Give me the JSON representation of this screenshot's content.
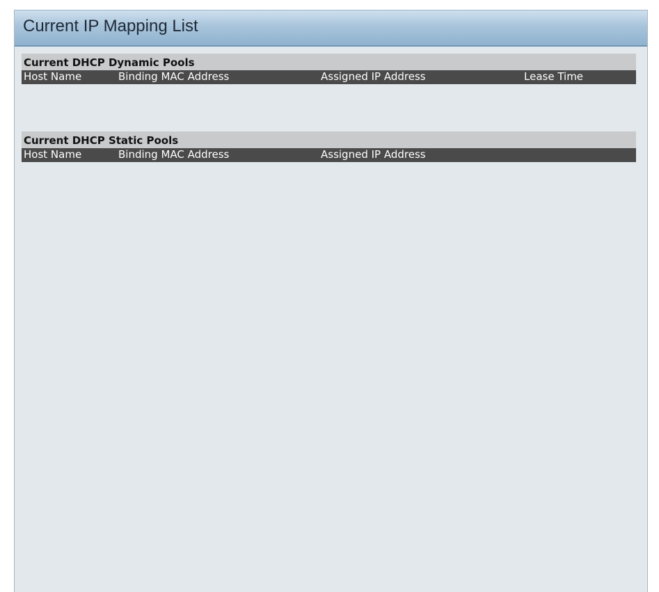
{
  "panel": {
    "title": "Current IP Mapping List"
  },
  "dynamic_pools": {
    "title": "Current DHCP Dynamic Pools",
    "columns": [
      "Host Name",
      "Binding MAC Address",
      "Assigned IP Address",
      "Lease Time"
    ],
    "rows": []
  },
  "static_pools": {
    "title": "Current DHCP Static Pools",
    "columns": [
      "Host Name",
      "Binding MAC Address",
      "Assigned IP Address"
    ],
    "rows": []
  },
  "colors": {
    "panel_background": "#e3e8ec",
    "header_gradient_top": "#cfe0ee",
    "header_gradient_bottom": "#8fb2cf",
    "section_title_background": "#c9cacb",
    "column_header_background": "#4a4a4a",
    "column_header_text": "#ffffff"
  }
}
